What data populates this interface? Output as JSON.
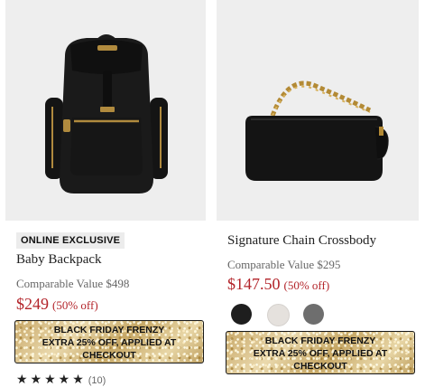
{
  "products": [
    {
      "badge": "ONLINE EXCLUSIVE",
      "name": "Baby Backpack",
      "comparable": "Comparable Value $498",
      "price": "$249",
      "discount": "(50% off)",
      "promo": [
        "BLACK FRIDAY FRENZY",
        "EXTRA 25% OFF, APPLIED AT",
        "CHECKOUT"
      ],
      "rating_count": "(10)",
      "image_icon": "black-backpack-image"
    },
    {
      "name": "Signature Chain Crossbody",
      "comparable": "Comparable Value $295",
      "price": "$147.50",
      "discount": "(50% off)",
      "swatches": [
        "#1e1e1e",
        "#e5e1dd",
        "#6e6e6e"
      ],
      "promo": [
        "BLACK FRIDAY FRENZY",
        "EXTRA 25% OFF, APPLIED AT",
        "CHECKOUT"
      ],
      "image_icon": "black-crossbody-bag-image"
    }
  ],
  "colors": {
    "sale": "#b3242a",
    "image_bg": "#eeeeee"
  }
}
